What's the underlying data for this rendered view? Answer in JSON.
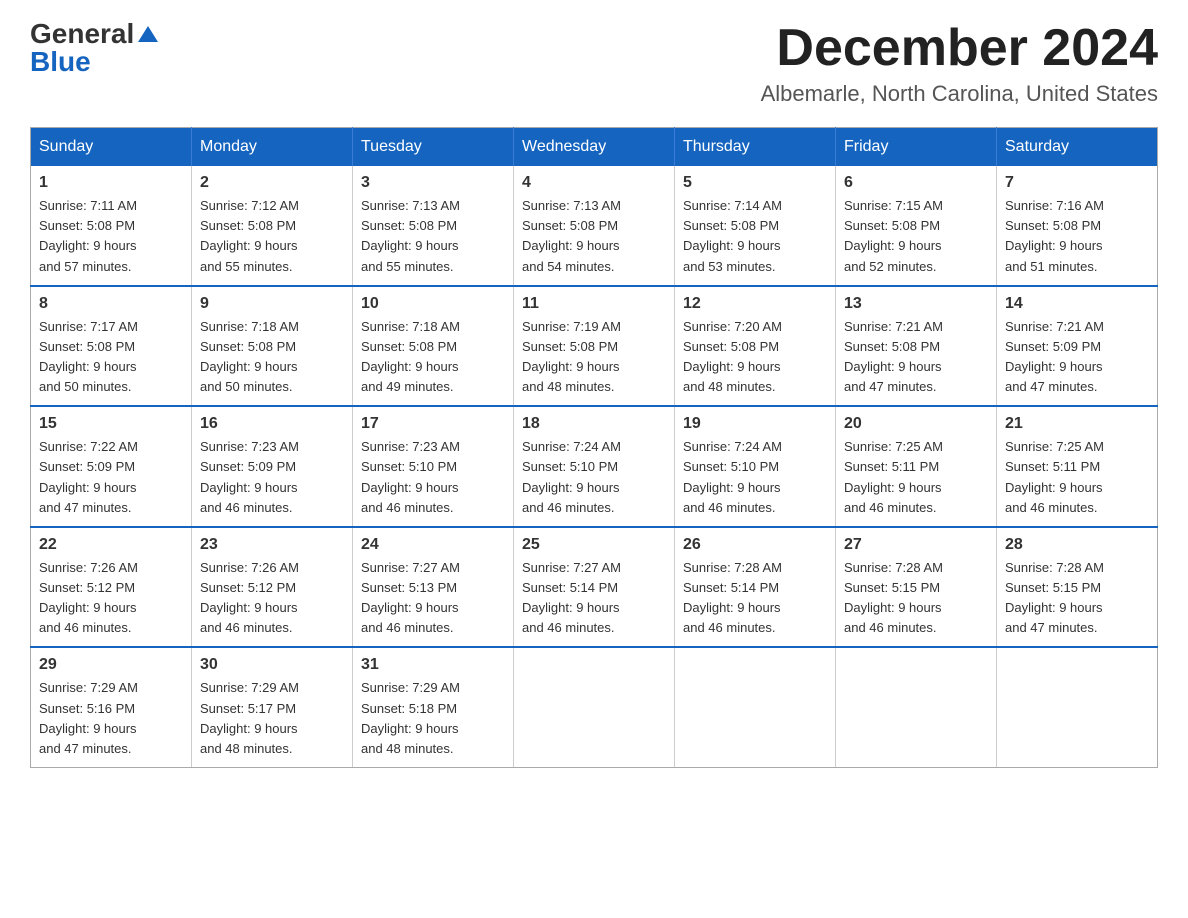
{
  "header": {
    "logo_general": "General",
    "logo_blue": "Blue",
    "month_title": "December 2024",
    "location": "Albemarle, North Carolina, United States"
  },
  "days_of_week": [
    "Sunday",
    "Monday",
    "Tuesday",
    "Wednesday",
    "Thursday",
    "Friday",
    "Saturday"
  ],
  "weeks": [
    [
      {
        "day": "1",
        "sunrise": "7:11 AM",
        "sunset": "5:08 PM",
        "daylight": "9 hours and 57 minutes."
      },
      {
        "day": "2",
        "sunrise": "7:12 AM",
        "sunset": "5:08 PM",
        "daylight": "9 hours and 55 minutes."
      },
      {
        "day": "3",
        "sunrise": "7:13 AM",
        "sunset": "5:08 PM",
        "daylight": "9 hours and 55 minutes."
      },
      {
        "day": "4",
        "sunrise": "7:13 AM",
        "sunset": "5:08 PM",
        "daylight": "9 hours and 54 minutes."
      },
      {
        "day": "5",
        "sunrise": "7:14 AM",
        "sunset": "5:08 PM",
        "daylight": "9 hours and 53 minutes."
      },
      {
        "day": "6",
        "sunrise": "7:15 AM",
        "sunset": "5:08 PM",
        "daylight": "9 hours and 52 minutes."
      },
      {
        "day": "7",
        "sunrise": "7:16 AM",
        "sunset": "5:08 PM",
        "daylight": "9 hours and 51 minutes."
      }
    ],
    [
      {
        "day": "8",
        "sunrise": "7:17 AM",
        "sunset": "5:08 PM",
        "daylight": "9 hours and 50 minutes."
      },
      {
        "day": "9",
        "sunrise": "7:18 AM",
        "sunset": "5:08 PM",
        "daylight": "9 hours and 50 minutes."
      },
      {
        "day": "10",
        "sunrise": "7:18 AM",
        "sunset": "5:08 PM",
        "daylight": "9 hours and 49 minutes."
      },
      {
        "day": "11",
        "sunrise": "7:19 AM",
        "sunset": "5:08 PM",
        "daylight": "9 hours and 48 minutes."
      },
      {
        "day": "12",
        "sunrise": "7:20 AM",
        "sunset": "5:08 PM",
        "daylight": "9 hours and 48 minutes."
      },
      {
        "day": "13",
        "sunrise": "7:21 AM",
        "sunset": "5:08 PM",
        "daylight": "9 hours and 47 minutes."
      },
      {
        "day": "14",
        "sunrise": "7:21 AM",
        "sunset": "5:09 PM",
        "daylight": "9 hours and 47 minutes."
      }
    ],
    [
      {
        "day": "15",
        "sunrise": "7:22 AM",
        "sunset": "5:09 PM",
        "daylight": "9 hours and 47 minutes."
      },
      {
        "day": "16",
        "sunrise": "7:23 AM",
        "sunset": "5:09 PM",
        "daylight": "9 hours and 46 minutes."
      },
      {
        "day": "17",
        "sunrise": "7:23 AM",
        "sunset": "5:10 PM",
        "daylight": "9 hours and 46 minutes."
      },
      {
        "day": "18",
        "sunrise": "7:24 AM",
        "sunset": "5:10 PM",
        "daylight": "9 hours and 46 minutes."
      },
      {
        "day": "19",
        "sunrise": "7:24 AM",
        "sunset": "5:10 PM",
        "daylight": "9 hours and 46 minutes."
      },
      {
        "day": "20",
        "sunrise": "7:25 AM",
        "sunset": "5:11 PM",
        "daylight": "9 hours and 46 minutes."
      },
      {
        "day": "21",
        "sunrise": "7:25 AM",
        "sunset": "5:11 PM",
        "daylight": "9 hours and 46 minutes."
      }
    ],
    [
      {
        "day": "22",
        "sunrise": "7:26 AM",
        "sunset": "5:12 PM",
        "daylight": "9 hours and 46 minutes."
      },
      {
        "day": "23",
        "sunrise": "7:26 AM",
        "sunset": "5:12 PM",
        "daylight": "9 hours and 46 minutes."
      },
      {
        "day": "24",
        "sunrise": "7:27 AM",
        "sunset": "5:13 PM",
        "daylight": "9 hours and 46 minutes."
      },
      {
        "day": "25",
        "sunrise": "7:27 AM",
        "sunset": "5:14 PM",
        "daylight": "9 hours and 46 minutes."
      },
      {
        "day": "26",
        "sunrise": "7:28 AM",
        "sunset": "5:14 PM",
        "daylight": "9 hours and 46 minutes."
      },
      {
        "day": "27",
        "sunrise": "7:28 AM",
        "sunset": "5:15 PM",
        "daylight": "9 hours and 46 minutes."
      },
      {
        "day": "28",
        "sunrise": "7:28 AM",
        "sunset": "5:15 PM",
        "daylight": "9 hours and 47 minutes."
      }
    ],
    [
      {
        "day": "29",
        "sunrise": "7:29 AM",
        "sunset": "5:16 PM",
        "daylight": "9 hours and 47 minutes."
      },
      {
        "day": "30",
        "sunrise": "7:29 AM",
        "sunset": "5:17 PM",
        "daylight": "9 hours and 48 minutes."
      },
      {
        "day": "31",
        "sunrise": "7:29 AM",
        "sunset": "5:18 PM",
        "daylight": "9 hours and 48 minutes."
      },
      null,
      null,
      null,
      null
    ]
  ],
  "labels": {
    "sunrise": "Sunrise:",
    "sunset": "Sunset:",
    "daylight": "Daylight: 9 hours"
  }
}
